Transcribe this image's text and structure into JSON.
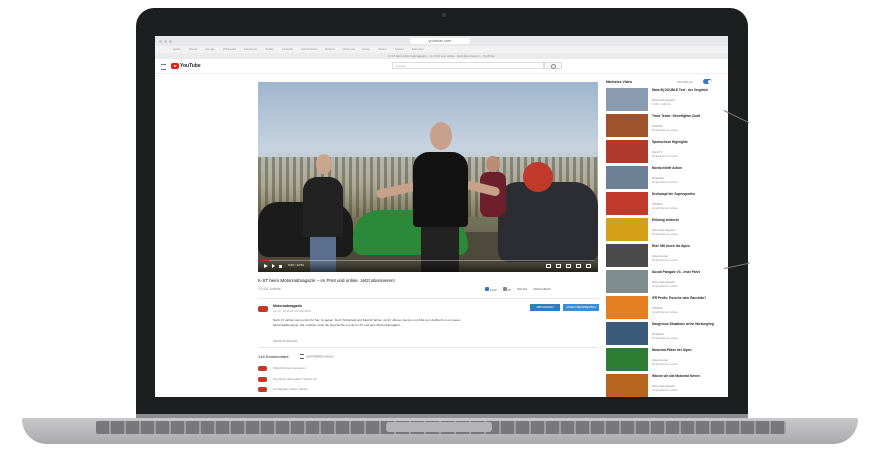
{
  "browser": {
    "url": "youtube.com",
    "tab_title": "K-ST beim Motorradmagazin – im Print und online. Jetzt abonnieren! – YouTube",
    "bookmarks": [
      "Apple",
      "iCloud",
      "Google",
      "Wikipedia",
      "Facebook",
      "Twitter",
      "LinkedIn",
      "Nachrichten",
      "Beliebt",
      "Motorrad",
      "Reise",
      "Wetter",
      "Karten",
      "Kalender"
    ]
  },
  "youtube": {
    "logo_text": "YouTube",
    "search_placeholder": "Suchen"
  },
  "video": {
    "time": "0:03 / 12:54",
    "progress": 0.02,
    "title": "K-ST beim Motorradmagazin – im Print und online. Jetzt abonnieren!",
    "views": "79.431 Aufrufe",
    "actions": {
      "like": "1400",
      "dislike": "26",
      "share": "TEILEN",
      "save": "SPEICHERN"
    }
  },
  "channel": {
    "name": "Motorradmagazin",
    "date": "Am 27.10.2018 veröffentlicht",
    "subscribe_label": "ABOLIEREN",
    "join_label": "VIDEO BEARBEITEN",
    "description": "Nach 17 Jahren war es Zeit für Sie, zu gehen. Doch Schönfeld und Dietrich fahren mit ihr offenen Herzen und Mut zum Aufbruch in ein neues Motorradabenteuer. Wir erzählen euch die Geschichte von der K-ST und dem Motorradmagazin.",
    "more_label": "MEHR ANSEHEN"
  },
  "comments": {
    "count_label": "134 Kommentare",
    "sort_label": "SORTIEREN NACH",
    "add_placeholder": "Öffentlich kommentieren...",
    "items": [
      {
        "text": "Top Motorradmagazin! Weiter so!"
      },
      {
        "text": "Großartiges Video, danke!"
      }
    ]
  },
  "sidebar": {
    "heading": "Nächstes Video",
    "autoplay_label": "AUTOPLAY",
    "items": [
      {
        "title": "Moto Bj DOUBLE Test - der Vergleich",
        "channel": "Motorradmagazin",
        "views": "2 Mio. Aufrufe",
        "color": "#8a9bb0"
      },
      {
        "title": "Track Tester: Streetfighter-Duell",
        "channel": "1000PS",
        "views": "Empfohlenes Video",
        "color": "#a0522d"
      },
      {
        "title": "Sportscheck Highlights",
        "channel": "MotoTV",
        "views": "Empfohlenes Video",
        "color": "#b03a2e"
      },
      {
        "title": "Nordschleife Action",
        "channel": "Ringkiller",
        "views": "Empfohlenes Video",
        "color": "#6d7f95"
      },
      {
        "title": "Dreikampf der Supersportler",
        "channel": "1000PS",
        "views": "Empfohlenes Video",
        "color": "#c0392b"
      },
      {
        "title": "Erlkönig entdeckt",
        "channel": "Motorradmagazin",
        "views": "Empfohlenes Video",
        "color": "#d4a017"
      },
      {
        "title": "Ride 360 durch die Alpen",
        "channel": "Alpentouren",
        "views": "Empfohlenes Video",
        "color": "#4a4a4a"
      },
      {
        "title": "Ducati Panigale V4 - erste Fahrt",
        "channel": "Motorradmagazin",
        "views": "Empfohlenes Video",
        "color": "#7f8c8d"
      },
      {
        "title": "IFR Profis: Porsche oder Racebike?",
        "channel": "1000PS",
        "views": "Empfohlenes Video",
        "color": "#e67e22"
      },
      {
        "title": "Dangerous Situations at the Nürburgring",
        "channel": "Ringkiller",
        "views": "Empfohlenes Video",
        "color": "#3b5b7a"
      },
      {
        "title": "Motorrad-Pässe der Alpen",
        "channel": "Alpentouren",
        "views": "Empfohlenes Video",
        "color": "#2e7d32"
      },
      {
        "title": "Warum wir alle Motorrad fahren",
        "channel": "Motorradmagazin",
        "views": "Empfohlenes Video",
        "color": "#b5651d"
      }
    ]
  }
}
